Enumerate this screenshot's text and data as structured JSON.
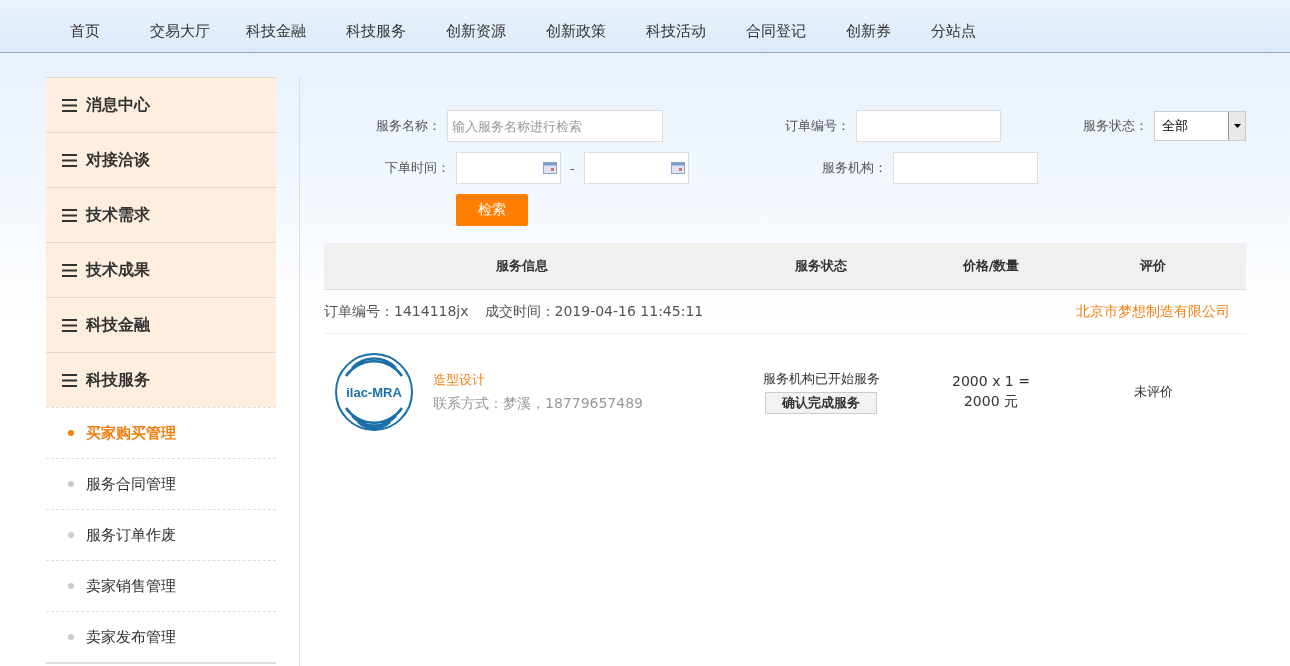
{
  "nav": [
    {
      "label": "首页"
    },
    {
      "label": "交易大厅"
    },
    {
      "label": "科技金融"
    },
    {
      "label": "科技服务"
    },
    {
      "label": "创新资源"
    },
    {
      "label": "创新政策"
    },
    {
      "label": "科技活动"
    },
    {
      "label": "合同登记"
    },
    {
      "label": "创新券"
    },
    {
      "label": "分站点"
    }
  ],
  "sidebar": {
    "sections": [
      {
        "label": "消息中心"
      },
      {
        "label": "对接洽谈"
      },
      {
        "label": "技术需求"
      },
      {
        "label": "技术成果"
      },
      {
        "label": "科技金融"
      },
      {
        "label": "科技服务"
      }
    ],
    "items": [
      {
        "label": "买家购买管理",
        "selected": true
      },
      {
        "label": "服务合同管理",
        "selected": false
      },
      {
        "label": "服务订单作废",
        "selected": false
      },
      {
        "label": "卖家销售管理",
        "selected": false
      },
      {
        "label": "卖家发布管理",
        "selected": false
      }
    ]
  },
  "search": {
    "name_label": "服务名称：",
    "name_placeholder": "输入服务名称进行检索",
    "order_label": "订单编号：",
    "status_label": "服务状态：",
    "status_value": "全部",
    "time_label": "下单时间：",
    "dash": "-",
    "org_label": "服务机构：",
    "button": "检索"
  },
  "table": {
    "columns": [
      "服务信息",
      "服务状态",
      "价格/数量",
      "评价"
    ],
    "orders": [
      {
        "order_no": "订单编号：1414118jx",
        "deal_time": "成交时间：2019-04-16 11:45:11",
        "company": "北京市梦想制造有限公司",
        "logo_text": "ilac-MRA",
        "service": "造型设计",
        "contact": "联系方式：梦溪，18779657489",
        "status": "服务机构已开始服务",
        "action": "确认完成服务",
        "price_line1": "2000 x 1 =",
        "price_line2": "2000 元",
        "review": "未评价"
      }
    ]
  }
}
